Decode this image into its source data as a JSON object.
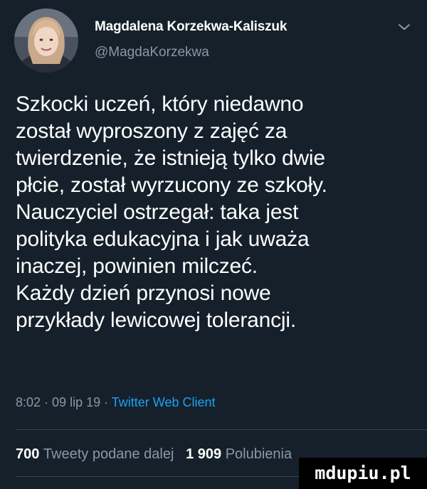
{
  "author": {
    "name": "Magdalena Korzekwa-Kaliszuk",
    "handle": "@MagdaKorzekwa"
  },
  "tweet": {
    "lines": [
      "Szkocki uczeń, który niedawno",
      "został wyproszony z zajęć za",
      "twierdzenie, że istnieją tylko dwie",
      "płcie, został wyrzucony ze szkoły.",
      "Nauczyciel ostrzegał: taka jest",
      "polityka edukacyjna i jak uważa",
      "inaczej, powinien milczeć.",
      "Każdy dzień przynosi nowe",
      "przykłady lewicowej tolerancji."
    ]
  },
  "meta": {
    "time": "8:02",
    "separator": " · ",
    "date": "09 lip 19",
    "client": "Twitter Web Client"
  },
  "stats": {
    "retweets_count": "700",
    "retweets_label": "Tweety podane dalej",
    "likes_count": "1 909",
    "likes_label": "Polubienia"
  },
  "watermark": "mdupiu.pl",
  "colors": {
    "background": "#15202b",
    "secondary_text": "#8899a6",
    "link": "#1da1f2",
    "divider": "#38444d"
  },
  "icons": {
    "avatar": "profile-photo",
    "menu": "chevron-down-icon"
  }
}
